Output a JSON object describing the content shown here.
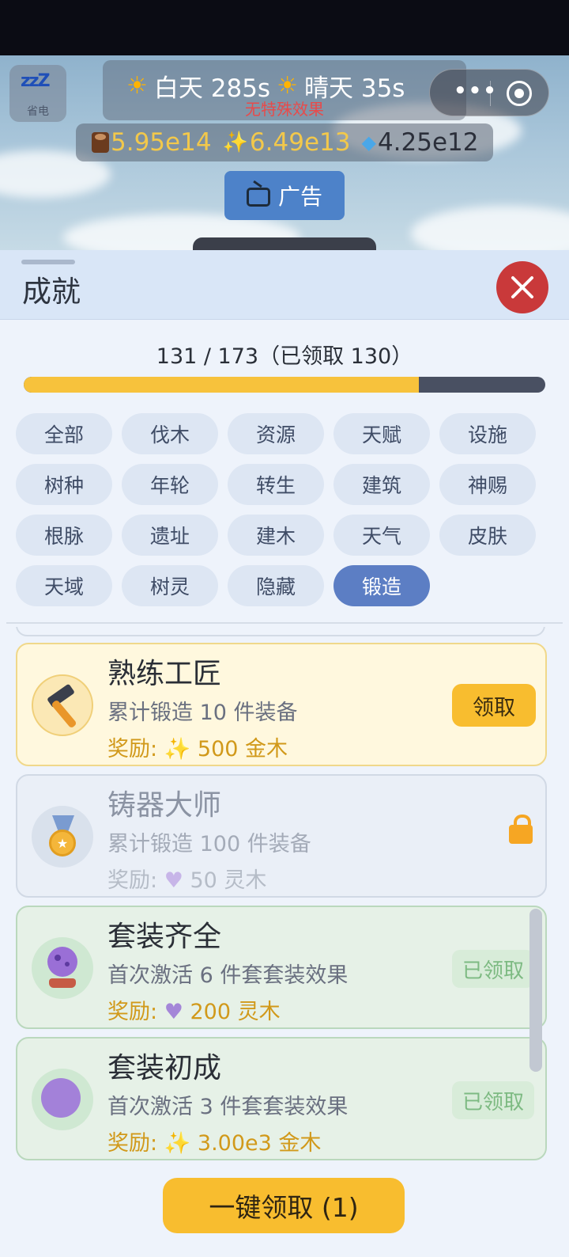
{
  "hud": {
    "sleep_label": "省电",
    "weather_time": "白天 285s",
    "weather_type": "晴天 35s",
    "weather_effect": "无特殊效果",
    "ad_label": "广告"
  },
  "resources": {
    "wood": "5.95e14",
    "gold": "6.49e13",
    "gem": "4.25e12"
  },
  "sheet": {
    "title": "成就",
    "progress_text": "131 / 173（已领取 130）",
    "progress_fraction": 0.757
  },
  "categories": [
    {
      "label": "全部",
      "active": false
    },
    {
      "label": "伐木",
      "active": false
    },
    {
      "label": "资源",
      "active": false
    },
    {
      "label": "天赋",
      "active": false
    },
    {
      "label": "设施",
      "active": false
    },
    {
      "label": "树种",
      "active": false
    },
    {
      "label": "年轮",
      "active": false
    },
    {
      "label": "转生",
      "active": false
    },
    {
      "label": "建筑",
      "active": false
    },
    {
      "label": "神赐",
      "active": false
    },
    {
      "label": "根脉",
      "active": false
    },
    {
      "label": "遗址",
      "active": false
    },
    {
      "label": "建木",
      "active": false
    },
    {
      "label": "天气",
      "active": false
    },
    {
      "label": "皮肤",
      "active": false
    },
    {
      "label": "天域",
      "active": false
    },
    {
      "label": "树灵",
      "active": false
    },
    {
      "label": "隐藏",
      "active": false
    },
    {
      "label": "锻造",
      "active": true
    }
  ],
  "achievements": [
    {
      "title": "熟练工匠",
      "desc": "累计锻造 10 件装备",
      "reward_prefix": "奖励:",
      "reward_icon": "sparkle-icon",
      "reward_text": "500 金木",
      "state": "claimable",
      "action_label": "领取"
    },
    {
      "title": "铸器大师",
      "desc": "累计锻造 100 件装备",
      "reward_prefix": "奖励:",
      "reward_icon": "heart-icon",
      "reward_text": "50 灵木",
      "state": "locked",
      "action_label": ""
    },
    {
      "title": "套装齐全",
      "desc": "首次激活 6 件套套装效果",
      "reward_prefix": "奖励:",
      "reward_icon": "heart-icon",
      "reward_text": "200 灵木",
      "state": "claimed",
      "action_label": "已领取"
    },
    {
      "title": "套装初成",
      "desc": "首次激活 3 件套套装效果",
      "reward_prefix": "奖励:",
      "reward_icon": "sparkle-icon",
      "reward_text": "3.00e3 金木",
      "state": "claimed",
      "action_label": "已领取"
    }
  ],
  "footer": {
    "claim_all_label": "一键领取 (1)"
  },
  "colors": {
    "accent_gold": "#f8bd2f",
    "active_chip": "#5c7ec4",
    "close_red": "#c9393a"
  }
}
